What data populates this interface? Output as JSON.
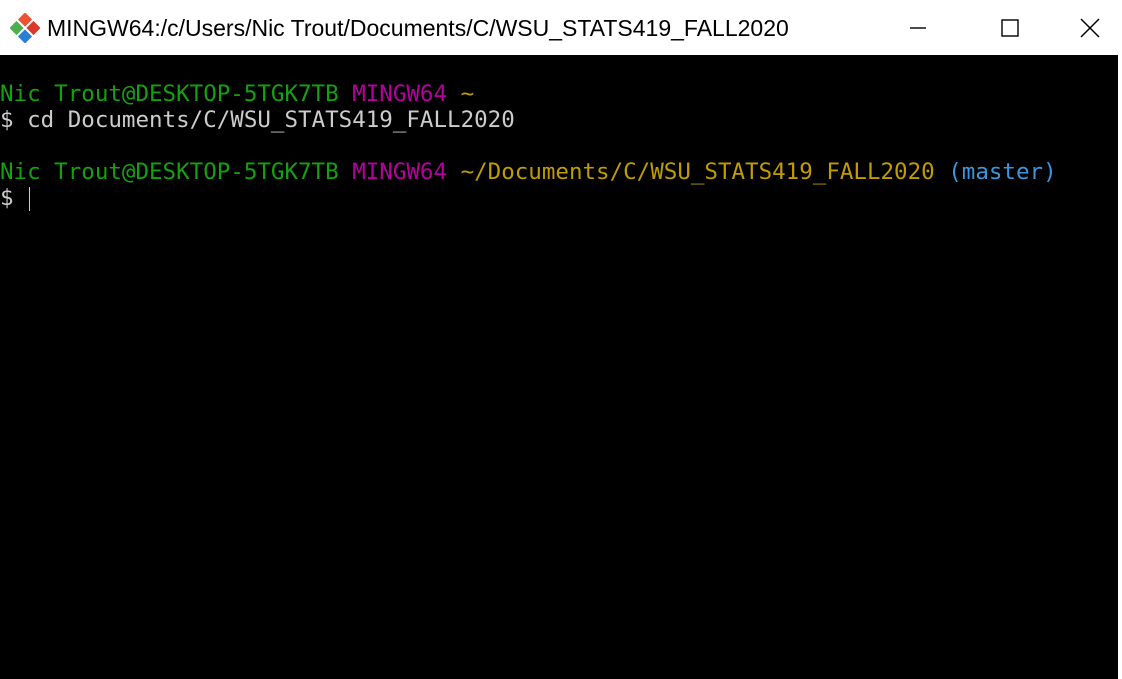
{
  "window": {
    "title": "MINGW64:/c/Users/Nic Trout/Documents/C/WSU_STATS419_FALL2020",
    "app_icon": "git-bash-icon",
    "controls": {
      "minimize": "minimize-icon",
      "maximize": "maximize-icon",
      "close": "close-icon"
    }
  },
  "terminal": {
    "colors": {
      "background": "#000000",
      "user_host": "#13a10e",
      "shell": "#b4009e",
      "path": "#c19c00",
      "branch": "#3a96dd",
      "text": "#cccccc"
    },
    "prompt1": {
      "user_host": "Nic Trout@DESKTOP-5TGK7TB",
      "shell": "MINGW64",
      "path": "~"
    },
    "command1": {
      "symbol": "$",
      "text": "cd Documents/C/WSU_STATS419_FALL2020"
    },
    "prompt2": {
      "user_host": "Nic Trout@DESKTOP-5TGK7TB",
      "shell": "MINGW64",
      "path": "~/Documents/C/WSU_STATS419_FALL2020",
      "branch": "(master)"
    },
    "command2": {
      "symbol": "$"
    }
  }
}
